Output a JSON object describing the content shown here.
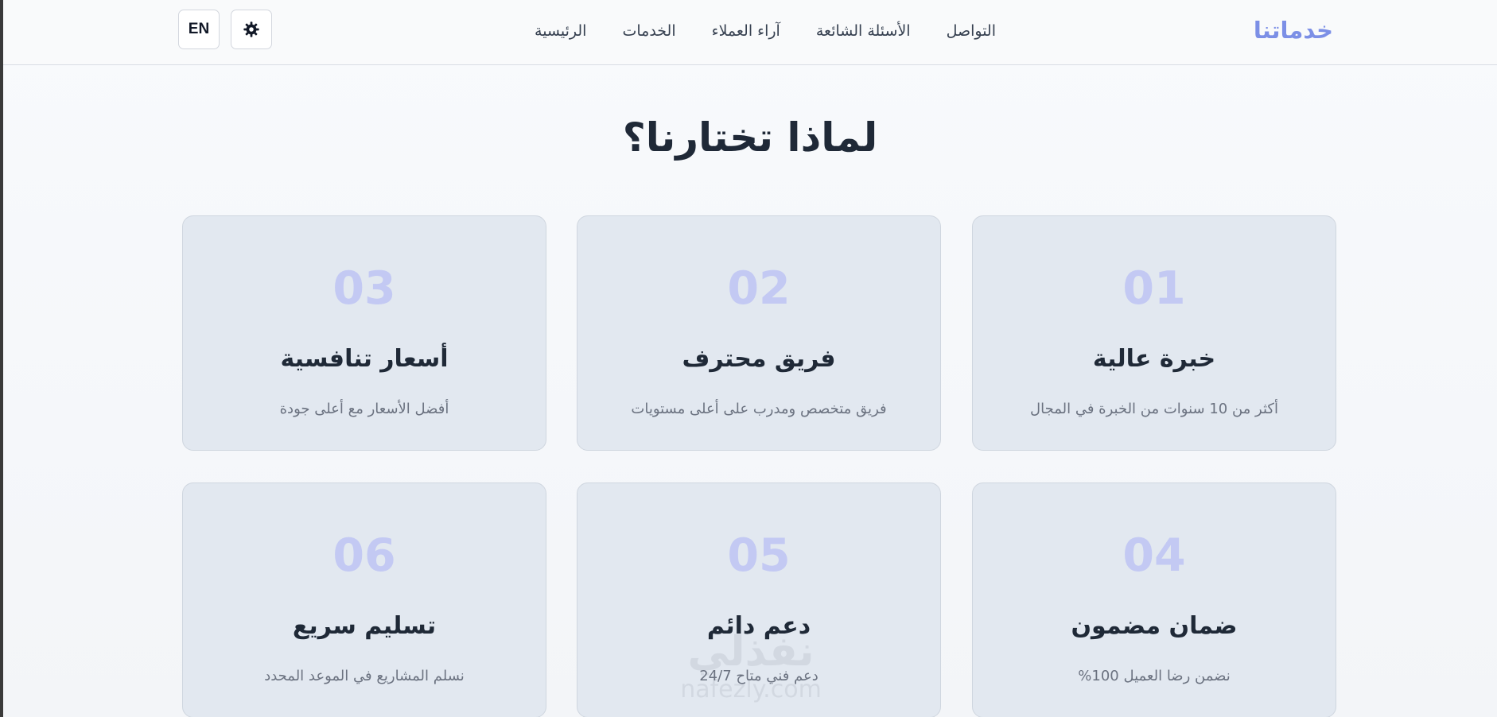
{
  "header": {
    "logo": "خدماتنا",
    "nav": [
      "الرئيسية",
      "الخدمات",
      "آراء العملاء",
      "الأسئلة الشائعة",
      "التواصل"
    ],
    "theme_toggle_icon": "gear-icon",
    "language_button": "EN"
  },
  "section": {
    "title": "لماذا تختارنا؟",
    "features": [
      {
        "number": "01",
        "title": "خبرة عالية",
        "description": "أكثر من 10 سنوات من الخبرة في المجال"
      },
      {
        "number": "02",
        "title": "فريق محترف",
        "description": "فريق متخصص ومدرب على أعلى مستويات"
      },
      {
        "number": "03",
        "title": "أسعار تنافسية",
        "description": "أفضل الأسعار مع أعلى جودة"
      },
      {
        "number": "04",
        "title": "ضمان مضمون",
        "description": "نضمن رضا العميل 100%"
      },
      {
        "number": "05",
        "title": "دعم دائم",
        "description": "دعم فني متاح 24/7"
      },
      {
        "number": "06",
        "title": "تسليم سريع",
        "description": "نسلم المشاريع في الموعد المحدد"
      }
    ]
  },
  "watermark": {
    "main": "نفذلي",
    "sub": "nafezly.com"
  },
  "colors": {
    "accent": "#7c8fe6",
    "card_bg": "#e2e8f0",
    "number": "#c3c9f3",
    "heading": "#1f2937",
    "muted": "#6b7280"
  }
}
